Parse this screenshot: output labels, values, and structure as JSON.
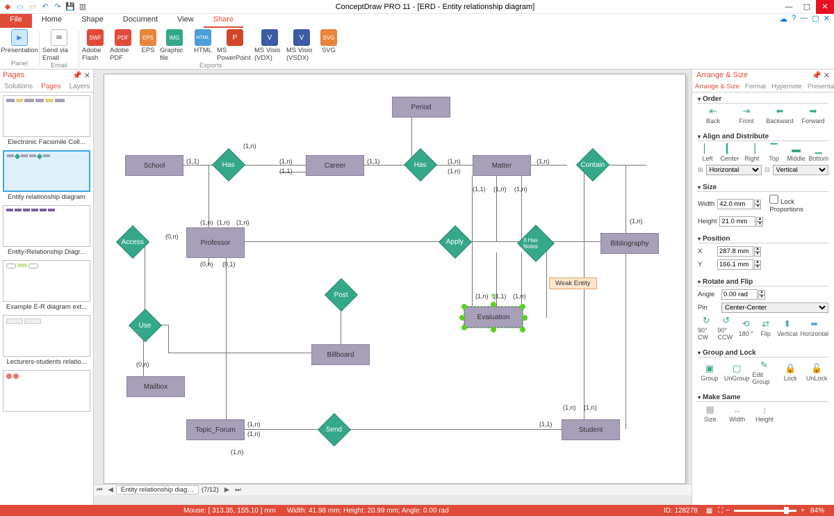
{
  "window": {
    "title": "ConceptDraw PRO 11 - [ERD - Entity relationship diagram]"
  },
  "ribbon_tabs": {
    "file": "File",
    "home": "Home",
    "shape": "Shape",
    "document": "Document",
    "view": "View",
    "share": "Share"
  },
  "ribbon": {
    "presentation": "Presentation",
    "send_email": "Send via Email",
    "adobe_flash": "Adobe Flash",
    "adobe_pdf": "Adobe PDF",
    "eps": "EPS",
    "graphic_file": "Graphic file",
    "html": "HTML",
    "ms_ppt": "MS PowerPoint",
    "visio_vdx": "MS Visio (VDX)",
    "visio_vsdx": "MS Visio (VSDX)",
    "svg": "SVG",
    "grp_panel": "Panel",
    "grp_email": "Email",
    "grp_exports": "Exports"
  },
  "pages_panel": {
    "title": "Pages",
    "tab_solutions": "Solutions",
    "tab_pages": "Pages",
    "tab_layers": "Layers",
    "thumbs": [
      "Electronic Facsimile Coll...",
      "Entity relationship diagram",
      "Entity-Relationship Diagr...",
      "Example E-R diagram ext...",
      "Lecturers-students relatio..."
    ]
  },
  "diagram": {
    "entities": {
      "school": "School",
      "career": "Career",
      "period": "Period",
      "matter": "Matter",
      "bibliography": "Bibliography",
      "professor": "Professor",
      "evaluation": "Evaluation",
      "billboard": "Billboard",
      "mailbox": "Mailbox",
      "topic_forum": "Topic_Forum",
      "student": "Student"
    },
    "relationships": {
      "has1": "Has",
      "has2": "Has",
      "contain": "Contain",
      "access": "Access",
      "apply": "Apply",
      "it_has_notes": "It Has Notes",
      "use": "Use",
      "post": "Post",
      "send": "Send"
    },
    "tooltip": "Weak Entity",
    "cards": {
      "c11": "(1,1)",
      "c1n": "(1,n)",
      "c0n": "(0,n)",
      "c01": "(0,1)"
    }
  },
  "right_panel": {
    "title": "Arrange & Size",
    "tab_as": "Arrange & Size",
    "tab_format": "Format",
    "tab_hypernote": "Hypernote",
    "tab_presentation": "Presentation",
    "sec_order": "Order",
    "order": {
      "back": "Back",
      "front": "Front",
      "backward": "Backward",
      "forward": "Forward"
    },
    "sec_align": "Align and Distribute",
    "align": {
      "left": "Left",
      "center": "Center",
      "right": "Right",
      "top": "Top",
      "middle": "Middle",
      "bottom": "Bottom",
      "horizontal": "Horizontal",
      "vertical": "Vertical"
    },
    "sec_size": "Size",
    "size": {
      "width_l": "Width",
      "width_v": "42.0 mm",
      "height_l": "Height",
      "height_v": "21.0 mm",
      "lock": "Lock Proportions"
    },
    "sec_position": "Position",
    "position": {
      "x_l": "X",
      "x_v": "287.8 mm",
      "y_l": "Y",
      "y_v": "166.1 mm"
    },
    "sec_rotate": "Rotate and Flip",
    "rotate": {
      "angle_l": "Angle",
      "angle_v": "0.00 rad",
      "pin_l": "Pin",
      "pin_v": "Center-Center",
      "cw90": "90° CW",
      "ccw90": "90° CCW",
      "d180": "180 °",
      "flip": "Flip",
      "vert": "Vertical",
      "horiz": "Horizontal"
    },
    "sec_group": "Group and Lock",
    "group": {
      "group": "Group",
      "ungroup": "UnGroup",
      "editg": "Edit Group",
      "lock": "Lock",
      "unlock": "UnLock"
    },
    "sec_make": "Make Same",
    "make": {
      "size": "Size",
      "width": "Width",
      "height": "Height"
    }
  },
  "doc_tabs": {
    "current": "Entity relationship diag…",
    "pager": "(7/12)"
  },
  "statusbar": {
    "mouse": "Mouse: [ 313.35, 155.10 ] mm",
    "dims": "Width: 41.98 mm; Height: 20.99 mm; Angle: 0.00 rad",
    "id": "ID: 128278",
    "zoom": "84%"
  }
}
